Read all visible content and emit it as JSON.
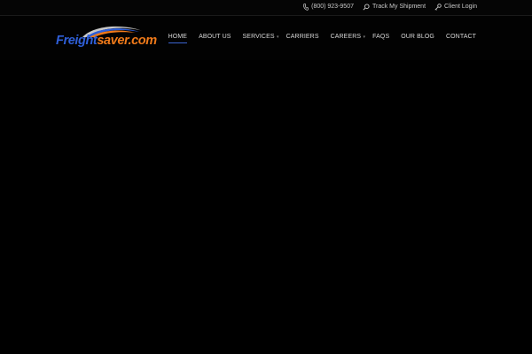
{
  "topbar": {
    "phone": "(800) 923-9507",
    "track": "Track My Shipment",
    "login": "Client Login"
  },
  "logo": {
    "part1": "Freight",
    "part2": "saver.com",
    "color_primary": "#2f5fd8",
    "color_accent": "#f07a1a"
  },
  "nav": {
    "items": [
      {
        "label": "HOME"
      },
      {
        "label": "ABOUT US"
      },
      {
        "label": "SERVICES"
      },
      {
        "label": "CARRIERS"
      },
      {
        "label": "CAREERS"
      },
      {
        "label": "FAQS"
      },
      {
        "label": "OUR BLOG"
      },
      {
        "label": "CONTACT"
      }
    ],
    "active_index": 0,
    "active_color": "#3c64d0"
  },
  "icons": {
    "phone": "phone-icon",
    "track": "search-icon",
    "login": "key-icon",
    "submenu": "chevron-down-icon"
  }
}
